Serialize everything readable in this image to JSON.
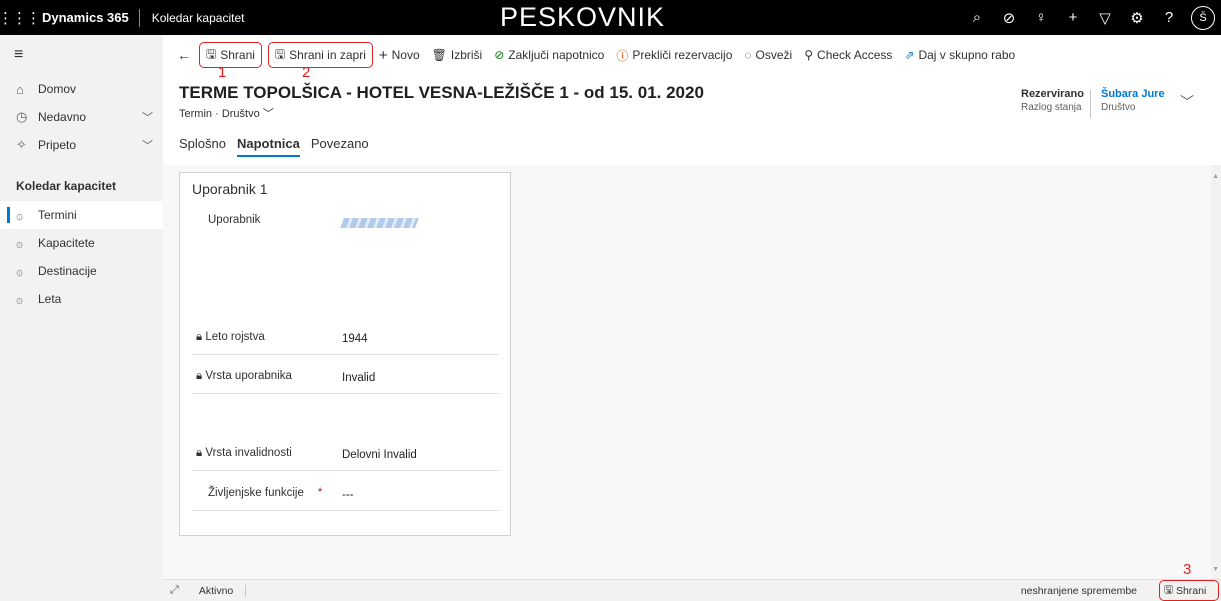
{
  "topbar": {
    "app_name": "Dynamics 365",
    "area_name": "Koledar kapacitet",
    "environment": "PESKOVNIK",
    "avatar": "Š"
  },
  "sidebar": {
    "nav": [
      {
        "label": "Domov",
        "icon": "home-icon"
      },
      {
        "label": "Nedavno",
        "icon": "clock-icon"
      },
      {
        "label": "Pripeto",
        "icon": "pin-icon"
      }
    ],
    "group_title": "Koledar kapacitet",
    "items": [
      {
        "label": "Termini",
        "active": true
      },
      {
        "label": "Kapacitete"
      },
      {
        "label": "Destinacije"
      },
      {
        "label": "Leta"
      }
    ]
  },
  "commands": {
    "save": "Shrani",
    "save_close": "Shrani in zapri",
    "new": "Novo",
    "delete": "Izbriši",
    "close_voucher": "Zaključi napotnico",
    "cancel_reservation": "Prekliči rezervacijo",
    "refresh": "Osveži",
    "check_access": "Check Access",
    "share": "Daj v skupno rabo"
  },
  "annotations": {
    "a1": "1",
    "a2": "2",
    "a3": "3"
  },
  "record": {
    "title": "TERME TOPOLŠICA - HOTEL VESNA-LEŽIŠČE 1 - od 15. 01. 2020",
    "entity": "Termin",
    "sep": "·",
    "form_name": "Društvo",
    "status_value": "Rezervirano",
    "status_label": "Razlog stanja",
    "owner_value": "Šubara Jure",
    "owner_label": "Društvo"
  },
  "tabs": [
    "Splošno",
    "Napotnica",
    "Povezano"
  ],
  "section": {
    "title": "Uporabnik 1",
    "fields": [
      {
        "label": "Uporabnik",
        "value": ""
      },
      {
        "label": "Leto rojstva",
        "value": "1944"
      },
      {
        "label": "Vrsta uporabnika",
        "value": "Invalid"
      },
      {
        "label": "Vrsta invalidnosti",
        "value": "Delovni Invalid"
      },
      {
        "label": "Življenjske funkcije",
        "value": "---",
        "required": "*"
      }
    ]
  },
  "footer": {
    "status": "Aktivno",
    "unsaved": "neshranjene spremembe",
    "save": "Shrani"
  },
  "colors": {
    "accent": "#0078d4",
    "highlight": "#e02020"
  }
}
